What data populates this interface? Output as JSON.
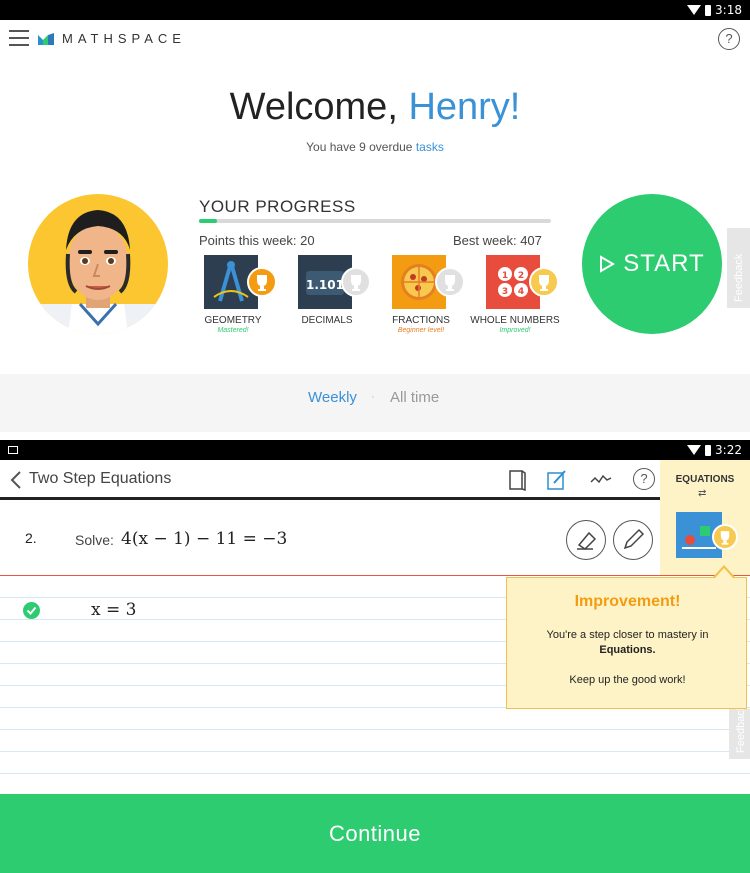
{
  "status_bar_top": {
    "time": "3:18"
  },
  "header": {
    "brand": "MATHSPACE",
    "help": "?"
  },
  "welcome": {
    "greeting": "Welcome, ",
    "name": "Henry!",
    "overdue_prefix": "You have 9 overdue ",
    "overdue_link": "tasks"
  },
  "progress": {
    "title": "YOUR PROGRESS",
    "fill_percent": 5,
    "points_this_week": "Points this week: 20",
    "best_week": "Best week: 407",
    "skills": [
      {
        "name": "GEOMETRY",
        "status": "Mastered!",
        "status_color": "#2ecc71",
        "tile_color": "#2c3e50",
        "badge_color": "#f39c12",
        "icon": "compass-icon"
      },
      {
        "name": "DECIMALS",
        "status": "",
        "status_color": "#999999",
        "tile_color": "#2c3e50",
        "badge_color": "#e0e0e0",
        "icon": "decimal-board-icon"
      },
      {
        "name": "FRACTIONS",
        "status": "Beginner level!",
        "status_color": "#e67e22",
        "tile_color": "#f39c12",
        "badge_color": "#e0e0e0",
        "icon": "pizza-icon"
      },
      {
        "name": "WHOLE NUMBERS",
        "status": "Improved!",
        "status_color": "#2ecc71",
        "tile_color": "#e74c3c",
        "badge_color": "#f7c94e",
        "icon": "number-dice-icon"
      }
    ]
  },
  "start": {
    "label": "START"
  },
  "feedback": {
    "label": "Feedback"
  },
  "tabs": {
    "weekly": "Weekly",
    "separator": "·",
    "all_time": "All time"
  },
  "status_bar_bottom": {
    "time": "3:22"
  },
  "lesson": {
    "title": "Two Step Equations",
    "question_number": "2.",
    "solve_label": "Solve:",
    "expression": "4(x − 1) − 11 = −3",
    "answer": "x = 3"
  },
  "equations_panel": {
    "label": "EQUATIONS",
    "swap": "⇄"
  },
  "popup": {
    "title": "Improvement!",
    "line1": "You're a step closer to mastery in",
    "line2": "Equations.",
    "line3": "Keep up the good work!"
  },
  "continue": {
    "label": "Continue"
  },
  "colors": {
    "accent_green": "#2ecc71",
    "accent_blue": "#3a91d6",
    "popup_bg": "#fef3c7"
  }
}
